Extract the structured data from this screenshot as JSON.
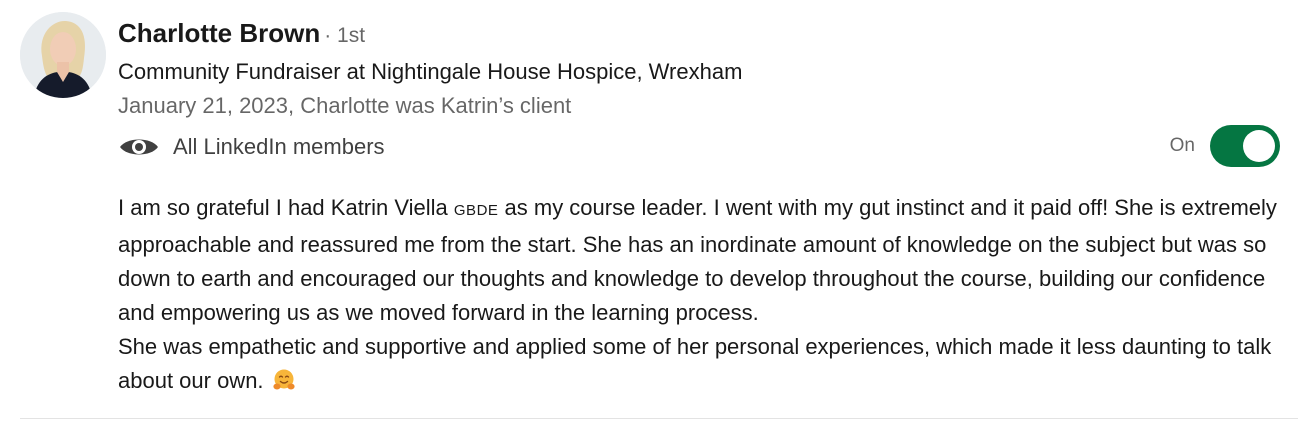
{
  "recommendation": {
    "author_name": "Charlotte Brown",
    "connection_degree": "· 1st",
    "headline": "Community Fundraiser at Nightingale House Hospice, Wrexham",
    "meta": "January 21, 2023, Charlotte was Katrin’s client",
    "visibility": {
      "icon": "eye-icon",
      "label": "All LinkedIn members"
    },
    "toggle": {
      "label": "On",
      "state": "on",
      "color": "#057642"
    },
    "body": {
      "line1_before": "I am so grateful I had Katrin Viella ",
      "name_suffix": "GBDE",
      "line1_after": " as my course leader. I went with my gut instinct and it paid off! She is extremely approachable and reassured me from the start. She has an inordinate amount of knowledge on the subject but was so down to earth and encouraged our thoughts and knowledge to develop throughout the course, building our confidence and empowering us as we moved forward in the learning process.",
      "paragraph2": "She was empathetic and supportive and applied some of her personal experiences, which made it less daunting to talk about our own.",
      "emoji": "hugging-face-icon"
    }
  }
}
